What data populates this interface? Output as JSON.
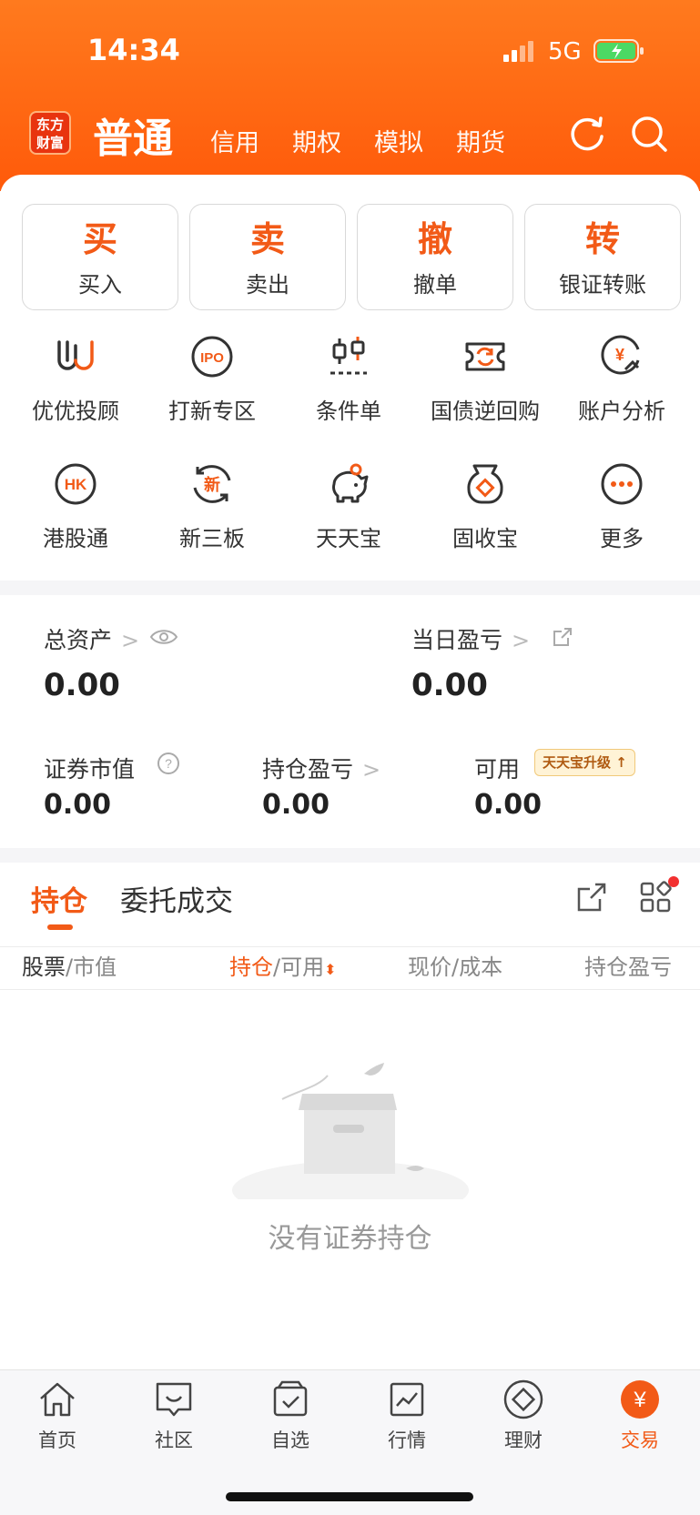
{
  "status_bar": {
    "time": "14:34",
    "network": "5G"
  },
  "header": {
    "logo": [
      "东方",
      "财富"
    ],
    "active_tab": "普通",
    "tabs": [
      "信用",
      "期权",
      "模拟",
      "期货"
    ]
  },
  "actions": [
    {
      "big": "买",
      "label": "买入"
    },
    {
      "big": "卖",
      "label": "卖出"
    },
    {
      "big": "撤",
      "label": "撤单"
    },
    {
      "big": "转",
      "label": "银证转账"
    }
  ],
  "features": [
    {
      "label": "优优投顾",
      "icon": "uu-advisor-icon"
    },
    {
      "label": "打新专区",
      "icon": "ipo-icon"
    },
    {
      "label": "条件单",
      "icon": "candlestick-icon"
    },
    {
      "label": "国债逆回购",
      "icon": "bond-repo-icon"
    },
    {
      "label": "账户分析",
      "icon": "account-analysis-icon"
    },
    {
      "label": "港股通",
      "icon": "hk-icon"
    },
    {
      "label": "新三板",
      "icon": "neeq-icon"
    },
    {
      "label": "天天宝",
      "icon": "piggy-bank-icon"
    },
    {
      "label": "固收宝",
      "icon": "money-bag-icon"
    },
    {
      "label": "更多",
      "icon": "more-icon"
    }
  ],
  "assets": {
    "total_label": "总资产",
    "total_value": "0.00",
    "daily_label": "当日盈亏",
    "daily_value": "0.00",
    "market_label": "证券市值",
    "market_value": "0.00",
    "pos_label": "持仓盈亏",
    "pos_value": "0.00",
    "avail_label": "可用",
    "avail_value": "0.00",
    "badge": "天天宝升级"
  },
  "holdings": {
    "tabs": [
      "持仓",
      "委托成交"
    ],
    "columns": {
      "c1a": "股票",
      "c1b": "市值",
      "c2a": "持仓",
      "c2b": "可用",
      "c3a": "现价",
      "c3b": "成本",
      "c4": "持仓盈亏"
    },
    "empty": "没有证券持仓"
  },
  "tabbar": [
    {
      "label": "首页",
      "icon": "home-icon"
    },
    {
      "label": "社区",
      "icon": "community-icon"
    },
    {
      "label": "自选",
      "icon": "watchlist-icon"
    },
    {
      "label": "行情",
      "icon": "market-icon"
    },
    {
      "label": "理财",
      "icon": "wealth-icon"
    },
    {
      "label": "交易",
      "icon": "trade-icon"
    }
  ],
  "colors": {
    "brand": "#f25a17",
    "header_top": "#ff7a1e",
    "header_bottom": "#ff5a0a"
  }
}
